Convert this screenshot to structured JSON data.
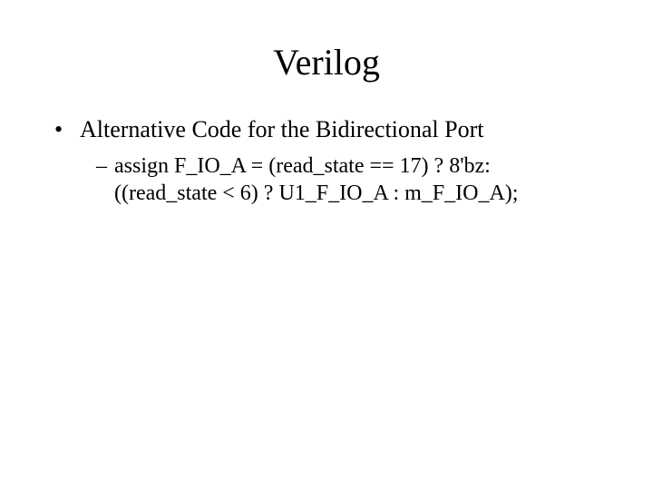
{
  "slide": {
    "title": "Verilog",
    "bullet1": {
      "text": "Alternative Code for the Bidirectional Port"
    },
    "sub1": {
      "line1": "assign F_IO_A = (read_state == 17) ? 8'bz:",
      "line2": "((read_state < 6) ? U1_F_IO_A : m_F_IO_A);"
    }
  }
}
